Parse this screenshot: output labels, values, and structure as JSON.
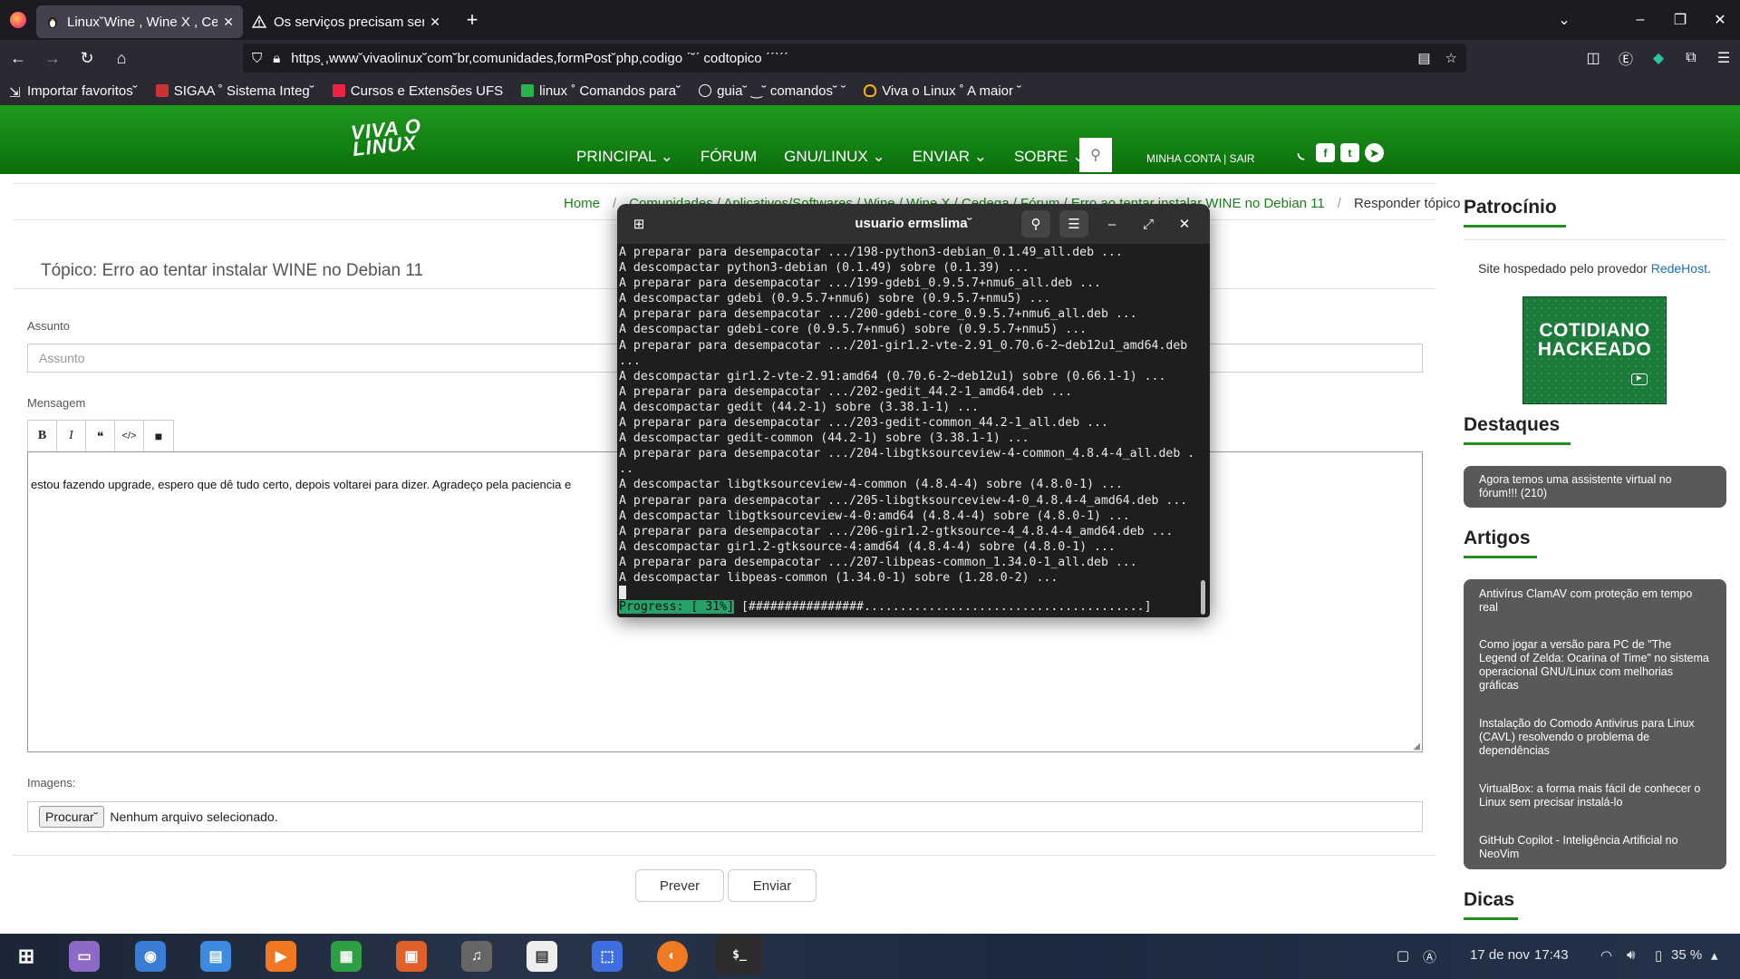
{
  "browser": {
    "tabs": [
      {
        "label": "Linux˘Wine , Wine X , Ce",
        "active": true
      },
      {
        "label": "Os serviços precisam ser",
        "active": false
      }
    ],
    "url": "https˛,www˘vivaolinux˘com˘br,comunidades,formPost˘php,codigo  ˊ˘ˊ  codtopico  ˊˊˋˊˊ",
    "bookmarks": [
      "Importar favoritos˘",
      "SIGAA ˚ Sistema Integ˘",
      "Cursos e Extensões UFS",
      "linux ˚ Comandos para˘",
      "guia˘ ‿˘ comandos˘ ˘",
      "Viva o Linux ˚ A maior ˘"
    ],
    "window_controls": [
      "–",
      "❐",
      "✕"
    ],
    "new_tab": "+"
  },
  "site": {
    "logo": "VIVA O\nLINUX",
    "nav": [
      "PRINCIPAL ⌄",
      "FÓRUM",
      "GNU/LINUX ⌄",
      "ENVIAR ⌄",
      "SOBRE ⌄"
    ],
    "account": "MINHA CONTA |  SAIR",
    "breadcrumb": {
      "home": "Home",
      "hidden": "Comunidades  /  Aplicativos/Softwares  /  Wine / Wine X / Cedega  /  Fórum  /  Erro ao tentar instalar WINE no Debian 11",
      "current": "Responder tópico"
    }
  },
  "form": {
    "topic_title": "Tópico: Erro ao tentar instalar WINE no Debian 11",
    "assunto_label": "Assunto",
    "assunto_placeholder": "Assunto",
    "mensagem_label": "Mensagem",
    "toolbar": [
      "B",
      "I",
      "❝",
      "</>",
      "■"
    ],
    "message_text": "estou fazendo upgrade, espero que dê tudo certo, depois voltarei para dizer. Agradeço pela paciencia e",
    "imagens_label": "Imagens:",
    "file_button": "Procurar˘",
    "file_status": "Nenhum arquivo selecionado.",
    "preview_button": "Prever",
    "send_button": "Enviar"
  },
  "sidebar": {
    "patrocinio_title": "Patrocínio",
    "sponsor_text": "Site hospedado pelo provedor ",
    "sponsor_link": "RedeHost",
    "sponsor_end": ".",
    "promo_text": "COTIDIANO\nHACKEADO",
    "destaques_title": "Destaques",
    "destaques": [
      "Agora temos uma assistente virtual no fórum!!! (210)"
    ],
    "artigos_title": "Artigos",
    "artigos": [
      "Antivírus ClamAV com proteção em tempo real",
      "Como jogar a versão para PC de \"The Legend of Zelda: Ocarina of Time\" no sistema operacional GNU/Linux com melhorias gráficas",
      "Instalação do Comodo Antivirus para Linux (CAVL) resolvendo o problema de dependências",
      "VirtualBox: a forma mais fácil de conhecer o Linux sem precisar instalá-lo",
      "GitHub Copilot - Inteligência Artificial no NeoVim"
    ],
    "dicas_title": "Dicas"
  },
  "terminal": {
    "title": "usuario   ermslima˘",
    "lines": [
      "A preparar para desempacotar .../198-python3-debian_0.1.49_all.deb ...",
      "A descompactar python3-debian (0.1.49) sobre (0.1.39) ...",
      "A preparar para desempacotar .../199-gdebi_0.9.5.7+nmu6_all.deb ...",
      "A descompactar gdebi (0.9.5.7+nmu6) sobre (0.9.5.7+nmu5) ...",
      "A preparar para desempacotar .../200-gdebi-core_0.9.5.7+nmu6_all.deb ...",
      "A descompactar gdebi-core (0.9.5.7+nmu6) sobre (0.9.5.7+nmu5) ...",
      "A preparar para desempacotar .../201-gir1.2-vte-2.91_0.70.6-2~deb12u1_amd64.deb",
      "...",
      "A descompactar gir1.2-vte-2.91:amd64 (0.70.6-2~deb12u1) sobre (0.66.1-1) ...",
      "A preparar para desempacotar .../202-gedit_44.2-1_amd64.deb ...",
      "A descompactar gedit (44.2-1) sobre (3.38.1-1) ...",
      "A preparar para desempacotar .../203-gedit-common_44.2-1_all.deb ...",
      "A descompactar gedit-common (44.2-1) sobre (3.38.1-1) ...",
      "A preparar para desempacotar .../204-libgtksourceview-4-common_4.8.4-4_all.deb .",
      "..",
      "A descompactar libgtksourceview-4-common (4.8.4-4) sobre (4.8.0-1) ...",
      "A preparar para desempacotar .../205-libgtksourceview-4-0_4.8.4-4_amd64.deb ...",
      "A descompactar libgtksourceview-4-0:amd64 (4.8.4-4) sobre (4.8.0-1) ...",
      "A preparar para desempacotar .../206-gir1.2-gtksource-4_4.8.4-4_amd64.deb ...",
      "A descompactar gir1.2-gtksource-4:amd64 (4.8.4-4) sobre (4.8.0-1) ...",
      "A preparar para desempacotar .../207-libpeas-common_1.34.0-1_all.deb ...",
      "A descompactar libpeas-common (1.34.0-1) sobre (1.28.0-2) ..."
    ],
    "progress_label": "Progress: [ 31%]",
    "progress_bar": " [################.......................................]",
    "progress_value": 0.31
  },
  "taskbar": {
    "date": "17 de nov",
    "time": "17:43",
    "battery": "35 %"
  }
}
